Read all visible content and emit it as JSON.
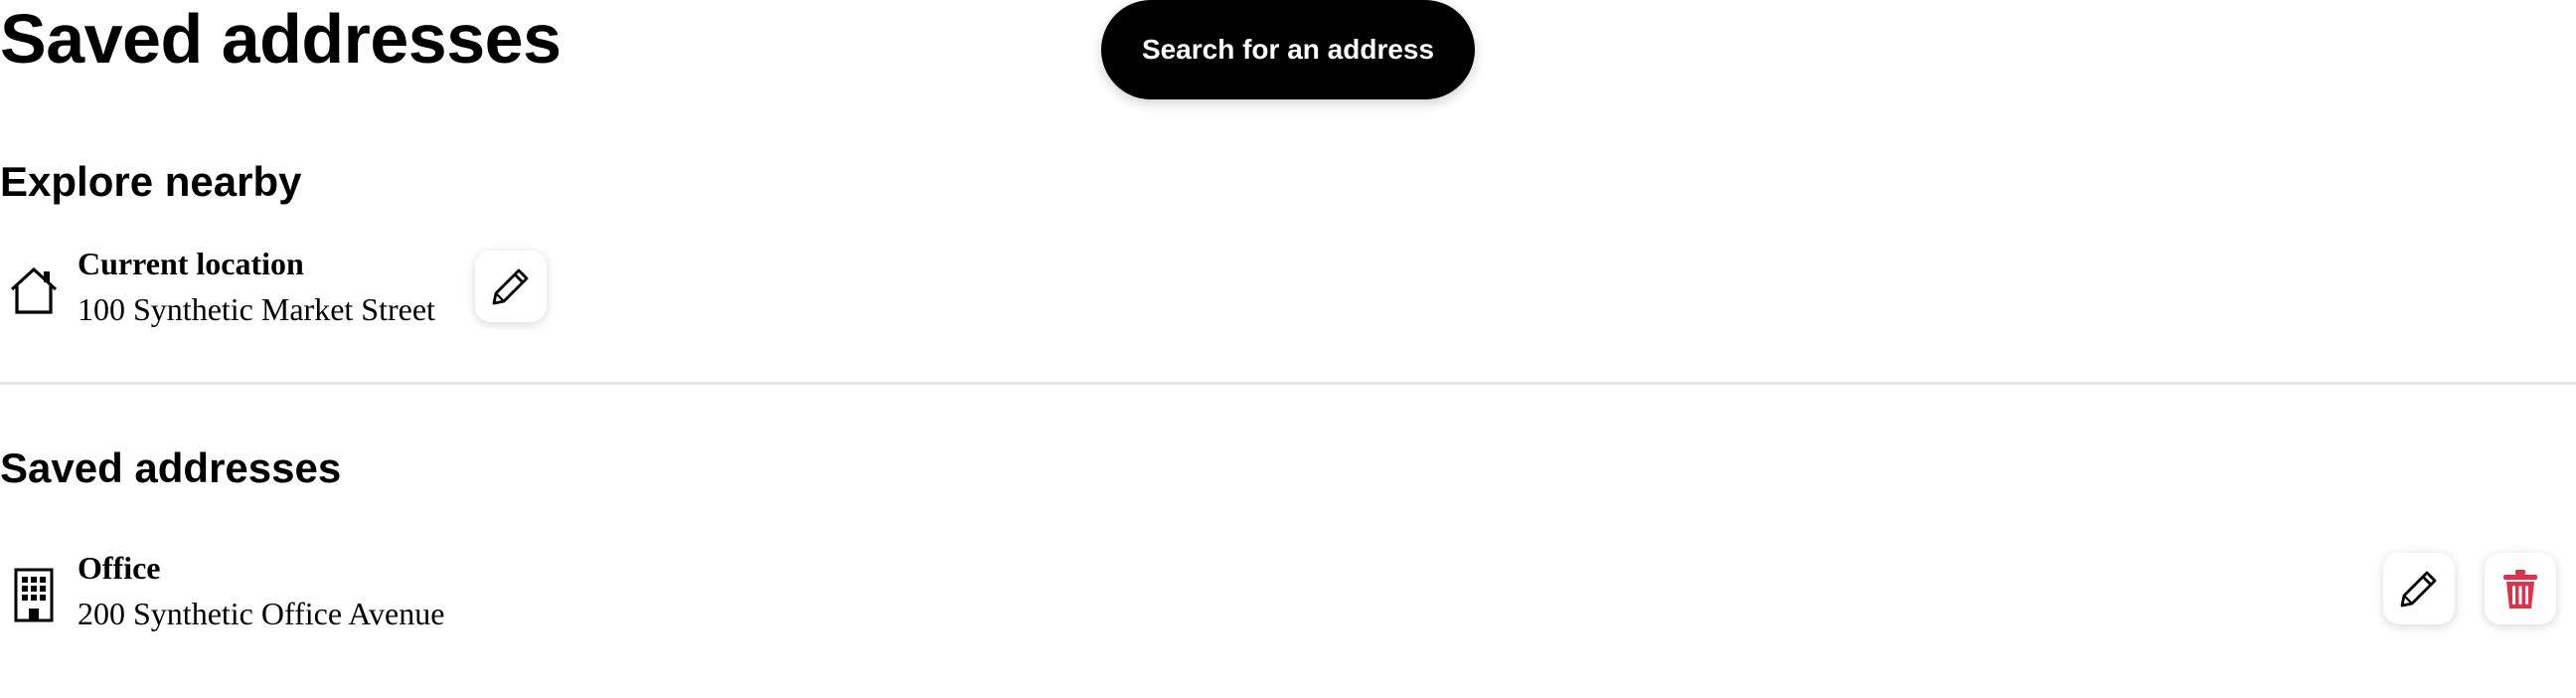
{
  "header": {
    "title": "Saved addresses",
    "search_button_label": "Search for an address"
  },
  "explore": {
    "heading": "Explore nearby",
    "current": {
      "name": "Current location",
      "address": "100 Synthetic Market Street",
      "icon": "home-icon",
      "edit_icon": "pencil-icon"
    }
  },
  "saved": {
    "heading": "Saved addresses",
    "items": [
      {
        "name": "Office",
        "address": "200 Synthetic Office Avenue",
        "icon": "office-building-icon",
        "edit_icon": "pencil-icon",
        "delete_icon": "trash-icon"
      }
    ]
  },
  "colors": {
    "primary_button_bg": "#000000",
    "primary_button_text": "#ffffff",
    "delete_accent": "#e0314b",
    "divider": "#e4e4e4"
  }
}
